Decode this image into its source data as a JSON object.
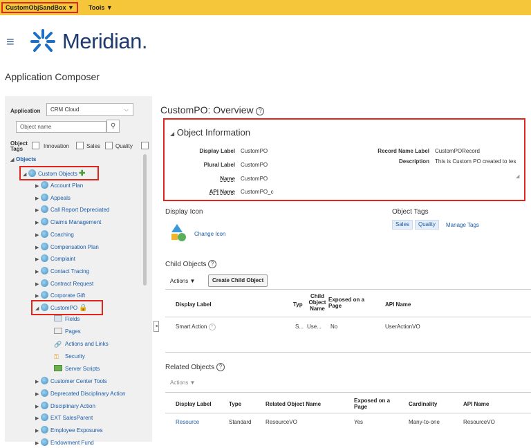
{
  "topbar": {
    "sandbox": "CustomObjSandBox ▼",
    "tools": "Tools ▼"
  },
  "brand": {
    "name": "Meridian."
  },
  "app_title": "Application Composer",
  "filters": {
    "application_label": "Application",
    "application_value": "CRM Cloud",
    "object_name_placeholder": "Object name",
    "object_tags_label": "Object Tags",
    "tags": [
      "Innovation",
      "Sales",
      "Quality"
    ]
  },
  "tree": {
    "root": "Objects",
    "custom_objects": "Custom Objects",
    "items": [
      "Account Plan",
      "Appeals",
      "Call Report Depreciated",
      "Claims Management",
      "Coaching",
      "Compensation Plan",
      "Complaint",
      "Contact Tracing",
      "Contract Request",
      "Corporate Gift"
    ],
    "selected": "CustomPO",
    "children": [
      "Fields",
      "Pages",
      "Actions and Links",
      "Security",
      "Server Scripts"
    ],
    "items_after": [
      "Customer Center Tools",
      "Deprecated Disciplinary Action",
      "Disciplinary Action",
      "EXT SalesParent",
      "Employee Exposures",
      "Endowment Fund"
    ]
  },
  "overview": {
    "title": "CustomPO: Overview",
    "object_info": {
      "title": "Object Information",
      "display_label_k": "Display Label",
      "display_label_v": "CustomPO",
      "plural_label_k": "Plural Label",
      "plural_label_v": "CustomPO",
      "name_k": "Name",
      "name_v": "CustomPO",
      "api_name_k": "API Name",
      "api_name_v": "CustomPO_c",
      "record_name_label_k": "Record Name Label",
      "record_name_label_v": "CustomPORecord",
      "description_k": "Description",
      "description_v": "This is Custom PO created to tes"
    },
    "display_icon": {
      "title": "Display Icon",
      "change": "Change Icon"
    },
    "object_tags": {
      "title": "Object Tags",
      "tags": [
        "Sales",
        "Quality"
      ],
      "manage": "Manage Tags"
    },
    "child_objects": {
      "title": "Child Objects",
      "actions": "Actions ▼",
      "create": "Create Child Object",
      "headers": [
        "Display Label",
        "Typ",
        "Child Object Name",
        "Exposed on a Page",
        "API Name"
      ],
      "row": {
        "label": "Smart Action",
        "type": "S...",
        "child": "Use...",
        "exposed": "No",
        "api": "UserActionVO"
      }
    },
    "related_objects": {
      "title": "Related Objects",
      "actions": "Actions ▼",
      "headers": [
        "Display Label",
        "Type",
        "Related Object Name",
        "Exposed on a Page",
        "Cardinality",
        "API Name"
      ],
      "row": {
        "label": "Resource",
        "type": "Standard",
        "related": "ResourceVO",
        "exposed": "Yes",
        "cardinality": "Many-to-one",
        "api": "ResourceVO"
      }
    }
  },
  "colors": {
    "accent_bar": "#f5c53a",
    "highlight": "#e0261b",
    "link": "#1b5ba6"
  }
}
